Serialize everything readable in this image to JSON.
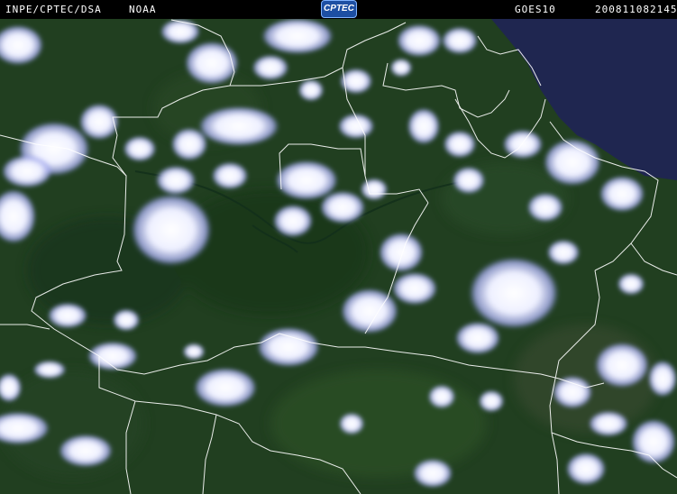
{
  "header": {
    "source": "INPE/CPTEC/DSA",
    "agency": "NOAA",
    "logo_text": "CPTEC",
    "satellite": "GOES10",
    "timestamp": "200811082145"
  },
  "colors": {
    "land": "#1f3d1f",
    "ocean": "#1d2448",
    "cloud": "#f2f3ff",
    "cloud_edge": "#7e86e8",
    "borders": "#ffffff"
  }
}
